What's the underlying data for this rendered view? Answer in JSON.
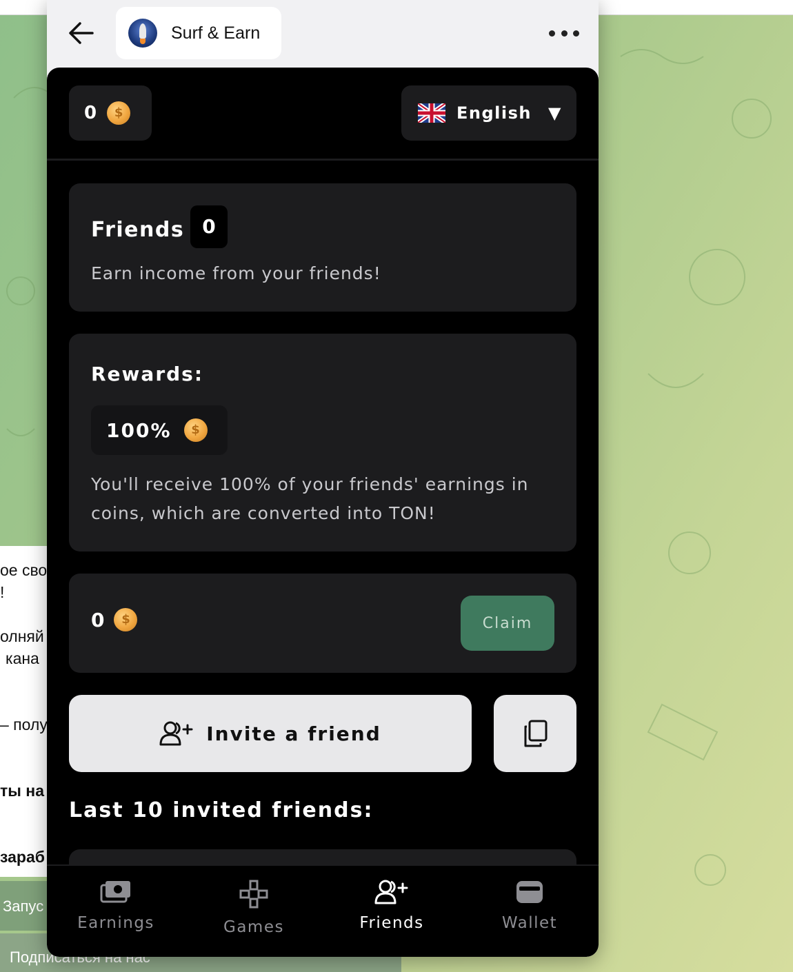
{
  "window": {
    "title": "Surf & Earn"
  },
  "header": {
    "balance": "0",
    "language": "English"
  },
  "friends": {
    "heading": "Friends",
    "count": "0",
    "subtitle": "Earn income from your friends!"
  },
  "rewards": {
    "heading": "Rewards:",
    "percent": "100%",
    "description": "You'll receive 100% of your friends' earnings in coins, which are converted into TON!"
  },
  "claim": {
    "amount": "0",
    "button_label": "Claim"
  },
  "invite": {
    "button_label": "Invite a friend",
    "copy_icon": "copy-icon"
  },
  "list": {
    "heading": "Last 10 invited friends:"
  },
  "tabs": [
    {
      "label": "Earnings",
      "icon": "money-icon",
      "active": false
    },
    {
      "label": "Games",
      "icon": "gamepad-icon",
      "active": false
    },
    {
      "label": "Friends",
      "icon": "add-user-icon",
      "active": true
    },
    {
      "label": "Wallet",
      "icon": "wallet-icon",
      "active": false
    }
  ],
  "background_chat": {
    "lines": [
      "ое сво",
      "!",
      "олняй",
      "кана",
      "– полу",
      "ты на",
      "зараб"
    ],
    "button_1": "Запус",
    "button_2": "Подписаться на нас"
  },
  "colors": {
    "app_background": "#000000",
    "card_background": "#1c1c1e",
    "claim_button": "#3f7a5e",
    "coin": "#f0a640",
    "invite_button": "#e8e8ea"
  }
}
